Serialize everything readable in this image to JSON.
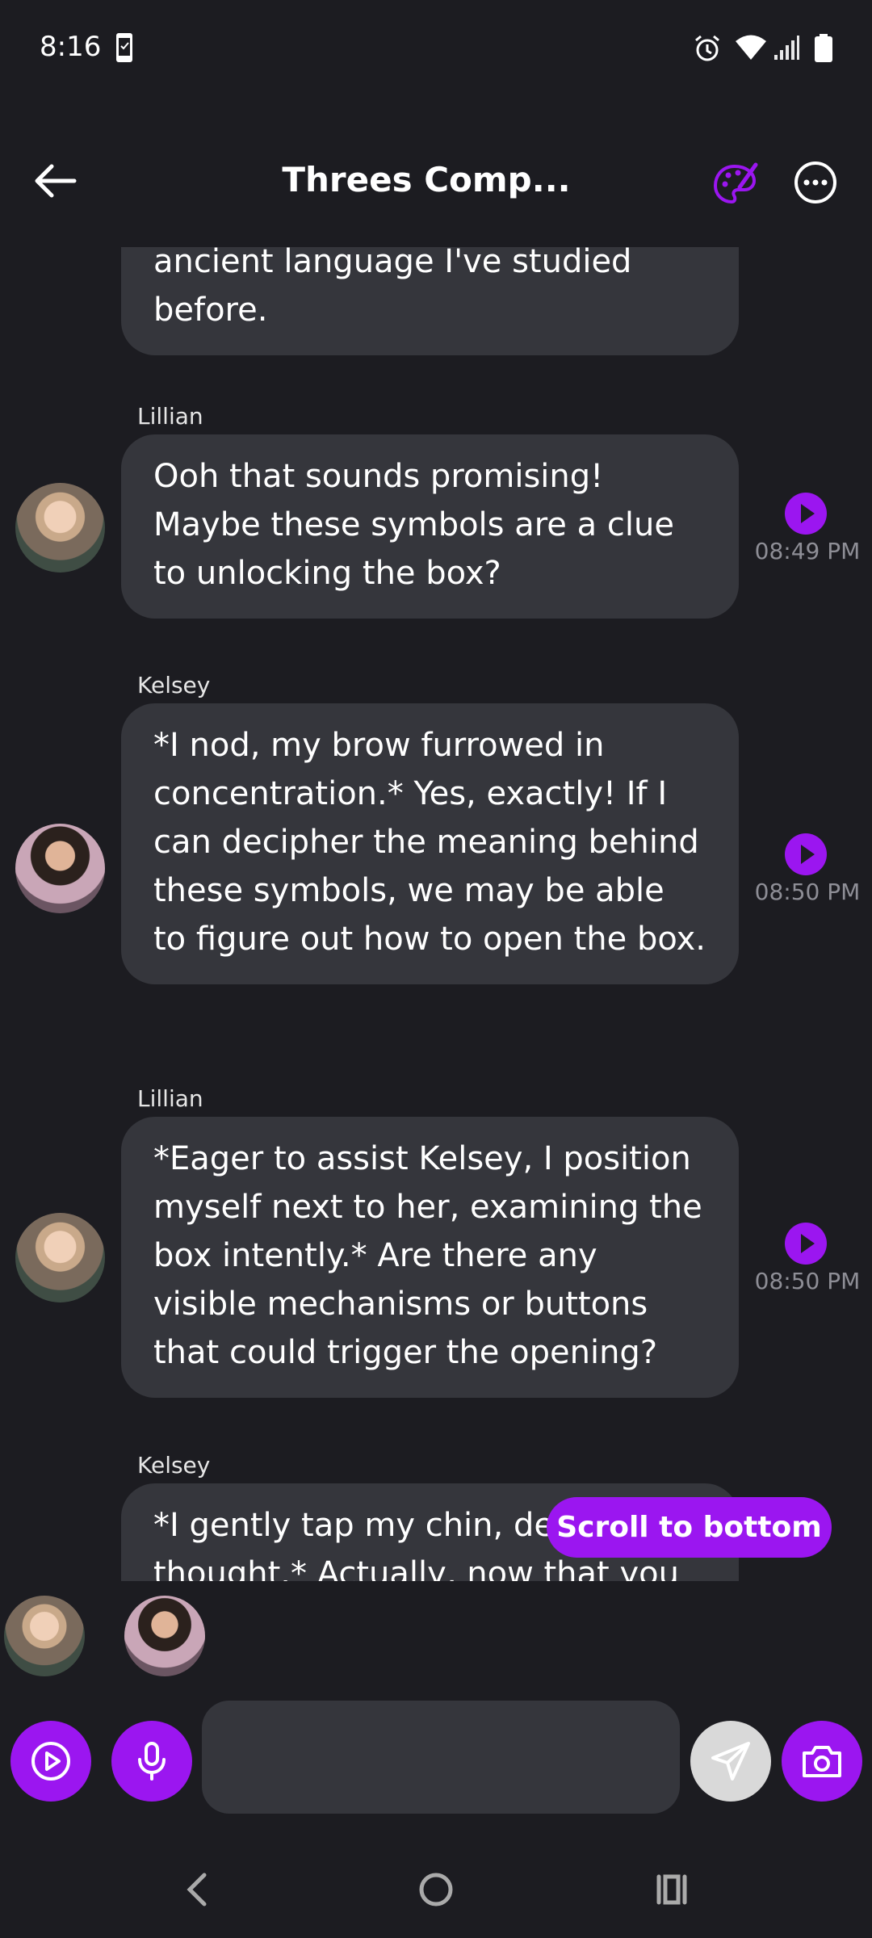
{
  "status_bar": {
    "time": "8:16"
  },
  "header": {
    "title": "Threes Comp..."
  },
  "messages": [
    {
      "sender": "",
      "text": "ancient language I've studied before.",
      "time": ""
    },
    {
      "sender": "Lillian",
      "text": "Ooh that sounds promising! Maybe these symbols are a clue to unlocking the box?",
      "time": "08:49 PM"
    },
    {
      "sender": "Kelsey",
      "text": "*I nod, my brow furrowed in concentration.* Yes, exactly! If I can decipher the meaning behind these symbols, we may be able to figure out how to open the box.",
      "time": "08:50 PM"
    },
    {
      "sender": "Lillian",
      "text": "*Eager to assist Kelsey, I position myself next to her, examining the box intently.* Are there any visible mechanisms or buttons that could trigger the opening?",
      "time": "08:50 PM"
    },
    {
      "sender": "Kelsey",
      "text": "*I gently tap my chin, deep in thought.* Actually, now that you",
      "time": ""
    }
  ],
  "scroll_button": {
    "label": "Scroll to bottom"
  },
  "input": {
    "placeholder": ""
  },
  "colors": {
    "accent": "#9b16f0",
    "background": "#1c1c21",
    "bubble": "#35363c",
    "time_text": "#8e8e96"
  },
  "icons": {
    "back": "arrow-left-icon",
    "palette": "palette-icon",
    "more": "more-horizontal-icon",
    "play": "play-icon",
    "video": "video-play-icon",
    "mic": "microphone-icon",
    "send": "send-icon",
    "camera": "camera-icon"
  }
}
